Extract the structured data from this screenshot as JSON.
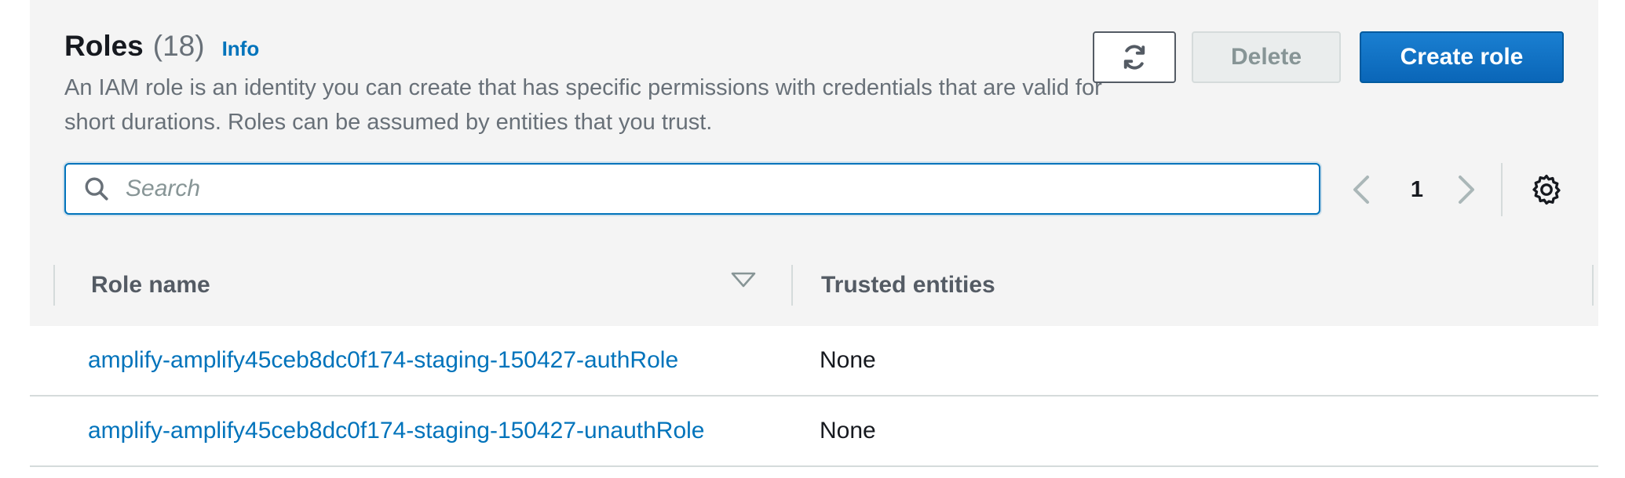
{
  "header": {
    "title": "Roles",
    "count": "(18)",
    "info_label": "Info",
    "description": "An IAM role is an identity you can create that has specific permissions with credentials that are valid for short durations. Roles can be assumed by entities that you trust."
  },
  "toolbar": {
    "refresh_icon": "refresh-icon",
    "delete_label": "Delete",
    "create_label": "Create role"
  },
  "search": {
    "placeholder": "Search",
    "value": ""
  },
  "pagination": {
    "current_page": "1",
    "prev_icon": "chevron-left-icon",
    "next_icon": "chevron-right-icon"
  },
  "settings": {
    "icon": "gear-icon"
  },
  "table": {
    "columns": [
      "Role name",
      "Trusted entities"
    ],
    "rows": [
      {
        "role_name": "amplify-amplify45ceb8dc0f174-staging-150427-authRole",
        "trusted_entities": "None"
      },
      {
        "role_name": "amplify-amplify45ceb8dc0f174-staging-150427-unauthRole",
        "trusted_entities": "None"
      }
    ]
  },
  "colors": {
    "link": "#0073bb",
    "primary_button": "#0073bb",
    "header_background": "#f4f4f4",
    "muted_text": "#687078"
  }
}
